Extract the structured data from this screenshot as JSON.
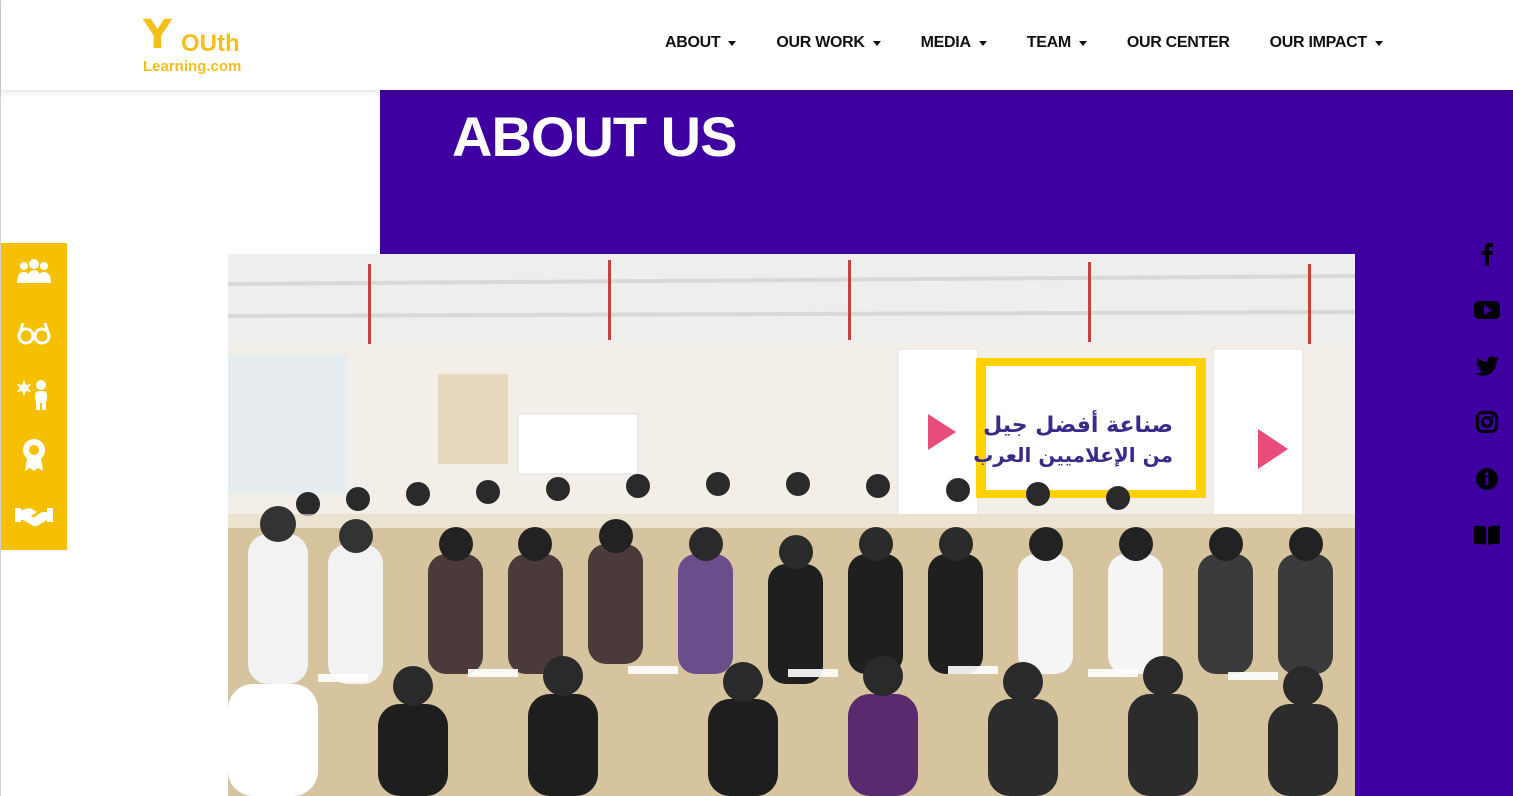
{
  "brand": {
    "logo_mark": "Y",
    "logo_word": "OUth",
    "logo_domain": "Learning.com",
    "color_yellow": "#f5c000",
    "color_purple": "#3e00a0"
  },
  "nav": [
    {
      "label": "ABOUT",
      "dropdown": true
    },
    {
      "label": "OUR WORK",
      "dropdown": true
    },
    {
      "label": "MEDIA",
      "dropdown": true
    },
    {
      "label": "TEAM",
      "dropdown": true
    },
    {
      "label": "OUR CENTER",
      "dropdown": false
    },
    {
      "label": "OUR IMPACT",
      "dropdown": true
    }
  ],
  "hero": {
    "title": "ABOUT US",
    "banner_line1": "صناعة أفضل جيل",
    "banner_line2": "من الإعلاميين العرب"
  },
  "left_sidebar_icons": [
    "users-group-icon",
    "glasses-icon",
    "child-care-icon",
    "award-icon",
    "handshake-icon"
  ],
  "social_icons": [
    "facebook-icon",
    "youtube-icon",
    "twitter-icon",
    "instagram-icon",
    "info-icon",
    "book-icon"
  ]
}
